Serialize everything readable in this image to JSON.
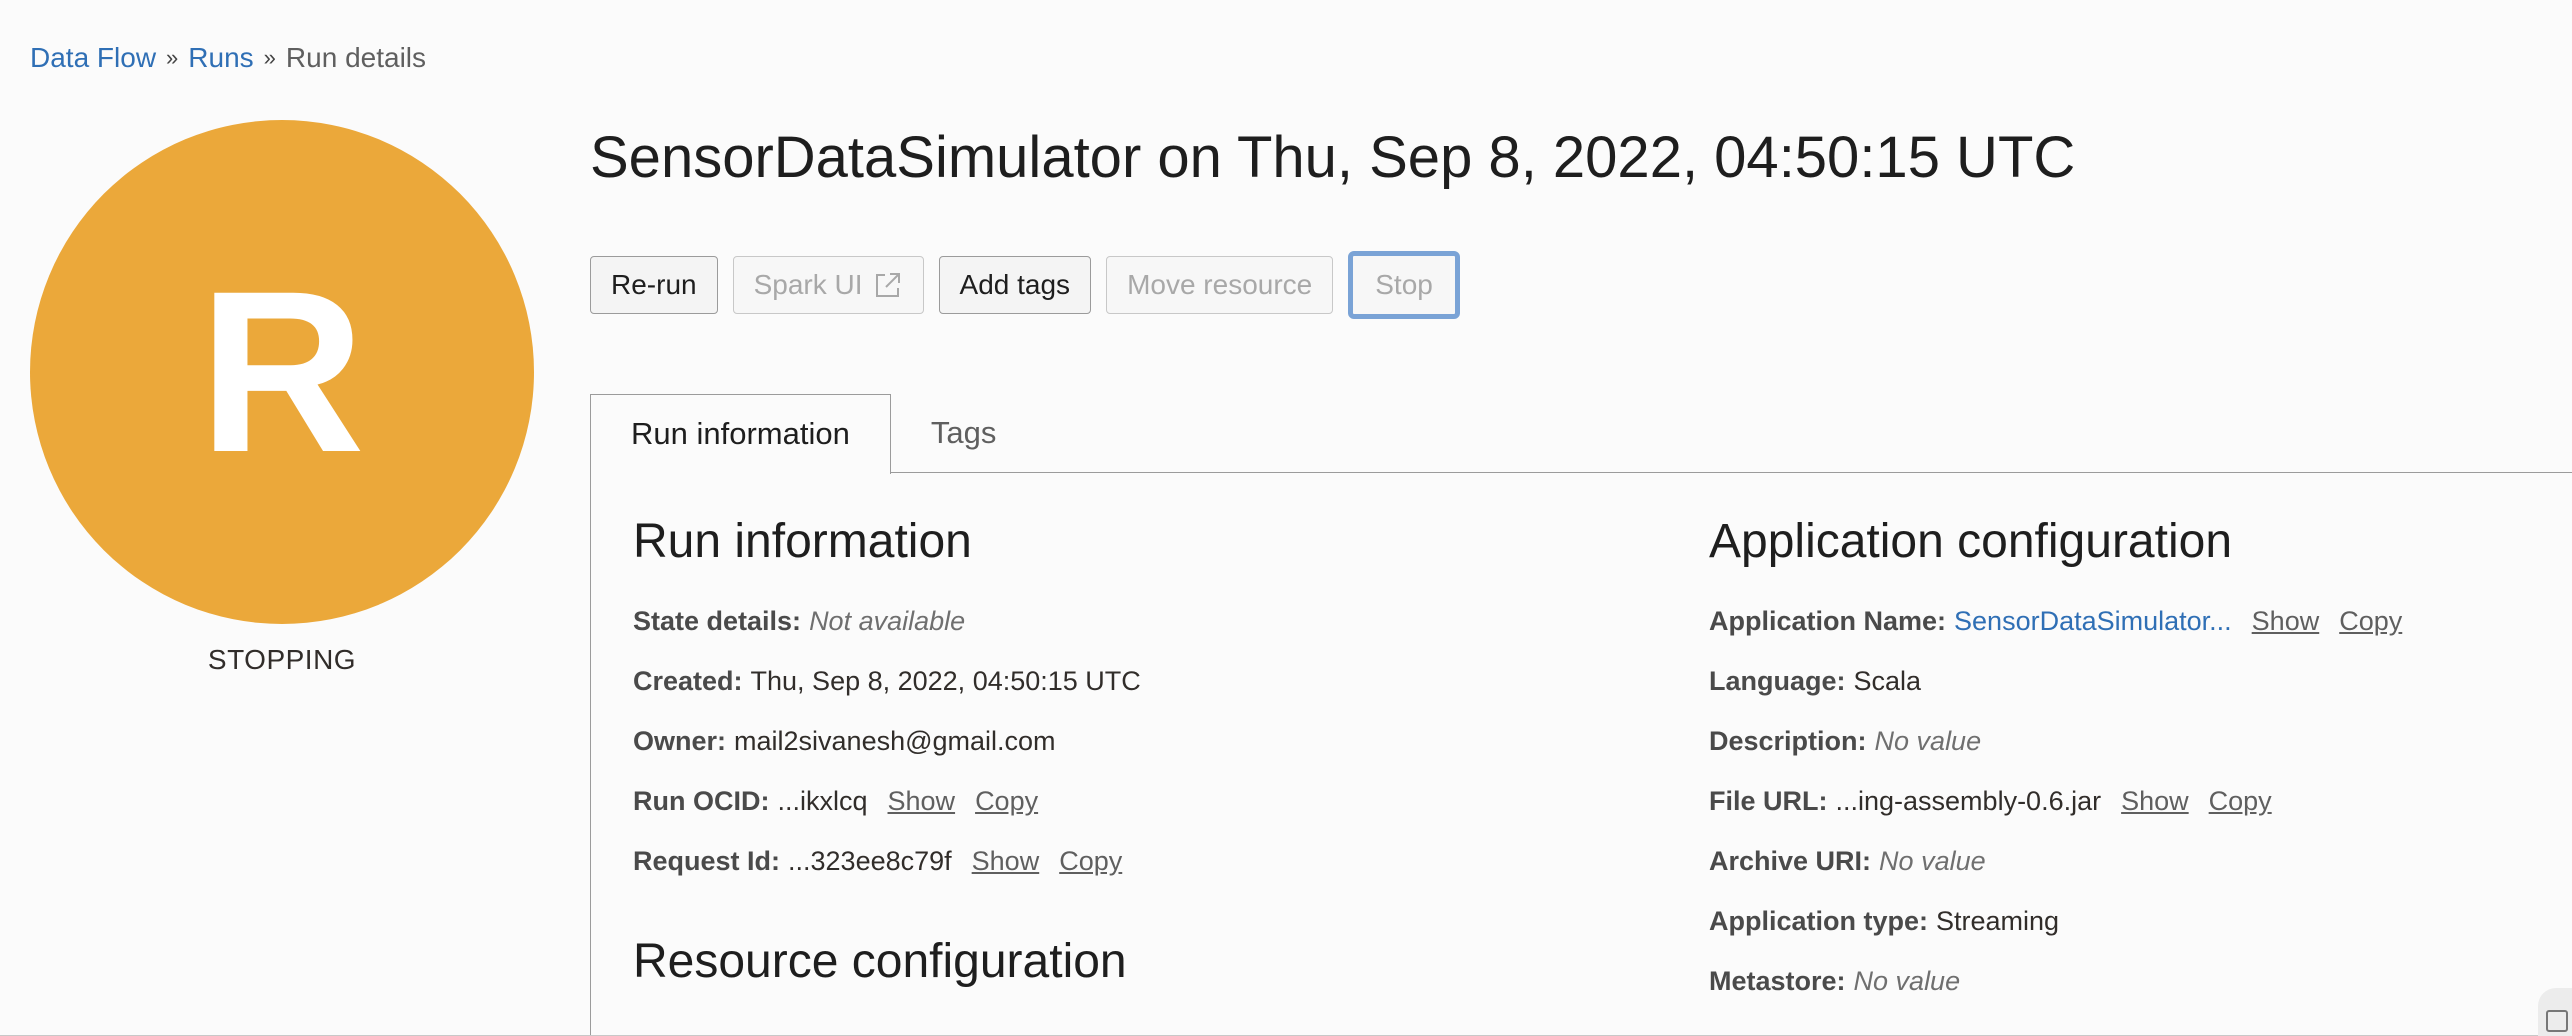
{
  "breadcrumb": {
    "items": [
      {
        "label": "Data Flow"
      },
      {
        "label": "Runs"
      }
    ],
    "current": "Run details"
  },
  "avatar": {
    "letter": "R",
    "color": "#eba83a"
  },
  "state": "STOPPING",
  "title": "SensorDataSimulator on Thu, Sep 8, 2022, 04:50:15 UTC",
  "toolbar": {
    "rerun": "Re-run",
    "spark_ui": "Spark UI",
    "spark_ui_icon": "external-link-icon",
    "add_tags": "Add tags",
    "move_resource": "Move resource",
    "stop": "Stop"
  },
  "tabs": [
    {
      "label": "Run information",
      "active": true
    },
    {
      "label": "Tags",
      "active": false
    }
  ],
  "run_info": {
    "heading": "Run information",
    "state_details": {
      "key": "State details:",
      "value": "Not available"
    },
    "created": {
      "key": "Created:",
      "value": "Thu, Sep 8, 2022, 04:50:15 UTC"
    },
    "owner": {
      "key": "Owner:",
      "value": "mail2sivanesh@gmail.com"
    },
    "run_ocid": {
      "key": "Run OCID:",
      "value": "...ikxlcq",
      "show": "Show",
      "copy": "Copy"
    },
    "request_id": {
      "key": "Request Id:",
      "value": "...323ee8c79f",
      "show": "Show",
      "copy": "Copy"
    }
  },
  "resource_config": {
    "heading": "Resource configuration"
  },
  "app_config": {
    "heading": "Application configuration",
    "app_name": {
      "key": "Application Name:",
      "value": "SensorDataSimulator...",
      "show": "Show",
      "copy": "Copy"
    },
    "language": {
      "key": "Language:",
      "value": "Scala"
    },
    "description": {
      "key": "Description:",
      "value": "No value"
    },
    "file_url": {
      "key": "File URL:",
      "value": "...ing-assembly-0.6.jar",
      "show": "Show",
      "copy": "Copy"
    },
    "archive_uri": {
      "key": "Archive URI:",
      "value": "No value"
    },
    "app_type": {
      "key": "Application type:",
      "value": "Streaming"
    },
    "metastore": {
      "key": "Metastore:",
      "value": "No value"
    }
  }
}
